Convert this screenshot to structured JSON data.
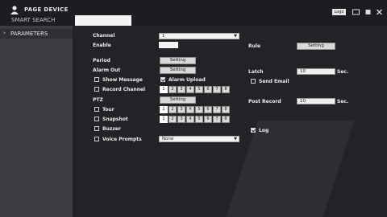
{
  "topbar": {
    "title": "PAGE DEVICE",
    "subtitle": "SMART SEARCH",
    "logout_label": "Logo"
  },
  "sidebar": {
    "items": [
      {
        "label": "PARAMETERS",
        "arrow": "›"
      }
    ]
  },
  "form": {
    "channel": {
      "label": "Channel",
      "value": "1"
    },
    "enable": {
      "label": "Enable"
    },
    "rule": {
      "label": "Rule",
      "button": "Setting"
    },
    "period": {
      "label": "Period",
      "button": "Setting"
    },
    "alarm_out": {
      "label": "Alarm Out",
      "button": "Setting"
    },
    "latch": {
      "label": "Latch",
      "value": "10",
      "unit": "Sec."
    },
    "show_message": {
      "label": "Show Message",
      "checked": false
    },
    "alarm_upload": {
      "label": "Alarm Upload",
      "checked": true
    },
    "send_email": {
      "label": "Send Email",
      "checked": false
    },
    "record_channel": {
      "label": "Record Channel",
      "checked": false,
      "channels": [
        "1",
        "2",
        "3",
        "4",
        "5",
        "6",
        "7",
        "8"
      ]
    },
    "ptz": {
      "label": "PTZ",
      "button": "Setting"
    },
    "post_record": {
      "label": "Post Record",
      "value": "10",
      "unit": "Sec."
    },
    "tour": {
      "label": "Tour",
      "checked": false,
      "channels": [
        "1",
        "2",
        "3",
        "4",
        "5",
        "6",
        "7",
        "8"
      ]
    },
    "snapshot": {
      "label": "Snapshot",
      "checked": false,
      "channels": [
        "1",
        "2",
        "3",
        "4",
        "5",
        "6",
        "7",
        "8"
      ]
    },
    "buzzer": {
      "label": "Buzzer",
      "checked": false
    },
    "log": {
      "label": "Log",
      "checked": true
    },
    "voice_prompts": {
      "label": "Voice Prompts",
      "checked": false,
      "value": "None"
    }
  }
}
